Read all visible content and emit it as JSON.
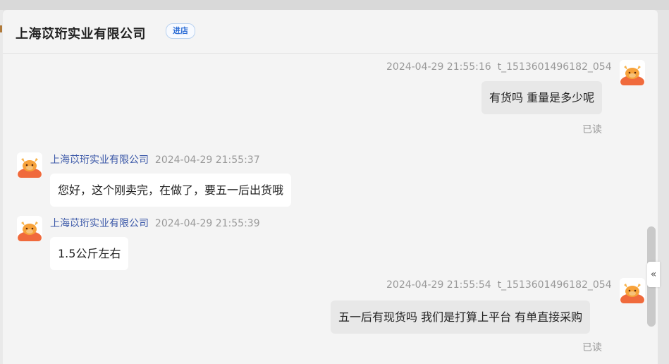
{
  "header": {
    "shop_name": "上海苡珩实业有限公司",
    "enter_shop": "进店"
  },
  "messages": [
    {
      "timestamp": "2024-04-29 21:55:16",
      "user_id": "t_1513601496182_054",
      "text": "有货吗 重量是多少呢",
      "status": "已读"
    },
    {
      "sender": "上海苡珩实业有限公司",
      "timestamp": "2024-04-29 21:55:37",
      "text": "您好，这个刚卖完，在做了，要五一后出货哦"
    },
    {
      "sender": "上海苡珩实业有限公司",
      "timestamp": "2024-04-29 21:55:39",
      "text": "1.5公斤左右"
    },
    {
      "timestamp": "2024-04-29 21:55:54",
      "user_id": "t_1513601496182_054",
      "text": "五一后有现货吗 我们是打算上平台 有单直接采购",
      "status": "已读"
    }
  ],
  "collapse_glyph": "«",
  "icons": {
    "avatar": "bull-avatar-icon",
    "collapse": "double-chevron-left-icon"
  }
}
